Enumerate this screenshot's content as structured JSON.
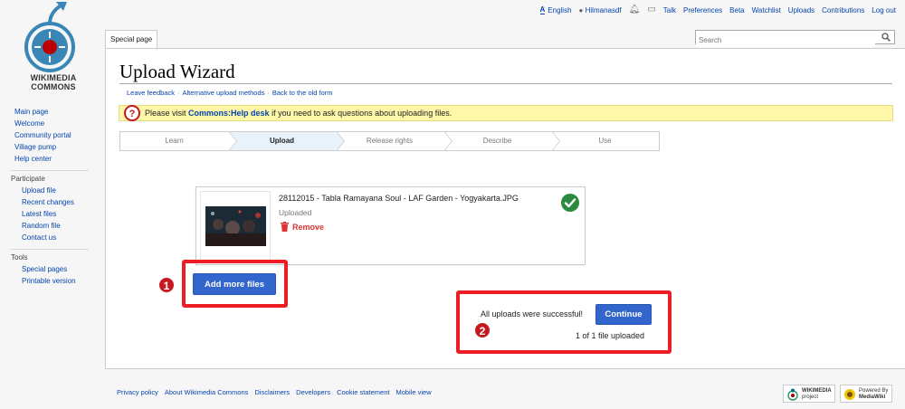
{
  "logo": {
    "wordmark_line1": "WIKIMEDIA",
    "wordmark_line2": "COMMONS"
  },
  "personal_tools": {
    "language_icon_text": "A",
    "language": "English",
    "username": "Hilmanasdf",
    "links": [
      "Talk",
      "Preferences",
      "Beta",
      "Watchlist",
      "Uploads",
      "Contributions",
      "Log out"
    ]
  },
  "tabs": {
    "special_page": "Special page"
  },
  "search": {
    "placeholder": "Search"
  },
  "sidebar": {
    "main_links": [
      "Main page",
      "Welcome",
      "Community portal",
      "Village pump",
      "Help center"
    ],
    "participate": {
      "heading": "Participate",
      "items": [
        "Upload file",
        "Recent changes",
        "Latest files",
        "Random file",
        "Contact us"
      ]
    },
    "tools": {
      "heading": "Tools",
      "items": [
        "Special pages",
        "Printable version"
      ]
    }
  },
  "page": {
    "title": "Upload Wizard",
    "subnav": [
      "Leave feedback",
      "Alternative upload methods",
      "Back to the old form"
    ],
    "notice": {
      "prefix": "Please visit ",
      "link": "Commons:Help desk",
      "suffix": " if you need to ask questions about uploading files."
    }
  },
  "steps": [
    {
      "label": "Learn",
      "active": false
    },
    {
      "label": "Upload",
      "active": true
    },
    {
      "label": "Release rights",
      "active": false
    },
    {
      "label": "Describe",
      "active": false
    },
    {
      "label": "Use",
      "active": false
    }
  ],
  "file": {
    "name": "28112015 - Tabla Ramayana Soul - LAF Garden - Yogyakarta.JPG",
    "status": "Uploaded",
    "remove_label": "Remove"
  },
  "actions": {
    "add_more_files": "Add more files",
    "success_message": "All uploads were successful!",
    "continue": "Continue",
    "uploaded_count": "1 of 1 file uploaded"
  },
  "callouts": {
    "one": "1",
    "two": "2"
  },
  "footer": {
    "links": [
      "Privacy policy",
      "About Wikimedia Commons",
      "Disclaimers",
      "Developers",
      "Cookie statement",
      "Mobile view"
    ],
    "wikimedia_badge_line1": "WIKIMEDIA",
    "wikimedia_badge_line2": "project",
    "mediawiki_badge_line1": "Powered By",
    "mediawiki_badge_line2": "MediaWiki"
  },
  "colors": {
    "accent": "#3366cc",
    "callout": "#ee1c24",
    "notice_bg": "#fef6a9",
    "success": "#2b8a3e",
    "remove": "#d33333"
  }
}
